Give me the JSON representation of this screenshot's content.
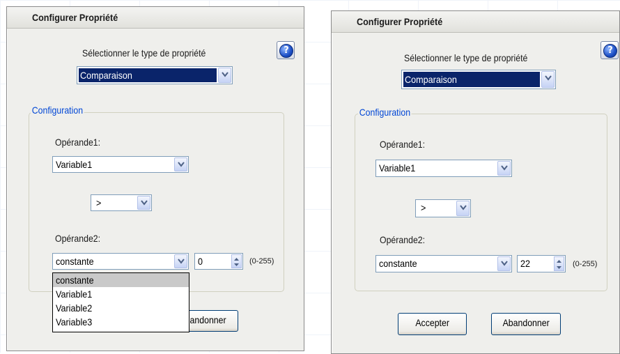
{
  "left_dialog": {
    "title": "Configurer Propriété",
    "property_type_label": "Sélectionner le type de propriété",
    "property_type_value": "Comparaison",
    "group_label": "Configuration",
    "operand1_label": "Opérande1:",
    "operand1_value": "Variable1",
    "operator_value": ">",
    "operand2_label": "Opérande2:",
    "operand2_value": "constante",
    "constant_value": "0",
    "range_label": "(0-255)",
    "dropdown_options": [
      "constante",
      "Variable1",
      "Variable2",
      "Variable3"
    ],
    "dropdown_highlighted": "constante",
    "cancel_label_visible": "andonner"
  },
  "right_dialog": {
    "title": "Configurer Propriété",
    "property_type_label": "Sélectionner le type de propriété",
    "property_type_value": "Comparaison",
    "group_label": "Configuration",
    "operand1_label": "Opérande1:",
    "operand1_value": "Variable1",
    "operator_value": ">",
    "operand2_label": "Opérande2:",
    "operand2_value": "constante",
    "constant_value": "22",
    "range_label": "(0-255)",
    "accept_label": "Accepter",
    "cancel_label": "Abandonner"
  },
  "icons": {
    "help": "?"
  },
  "colors": {
    "dialog_bg": "#efefec",
    "selection": "#0a246a",
    "group_label": "#0046d5",
    "highlight": "#c9c9c9"
  }
}
